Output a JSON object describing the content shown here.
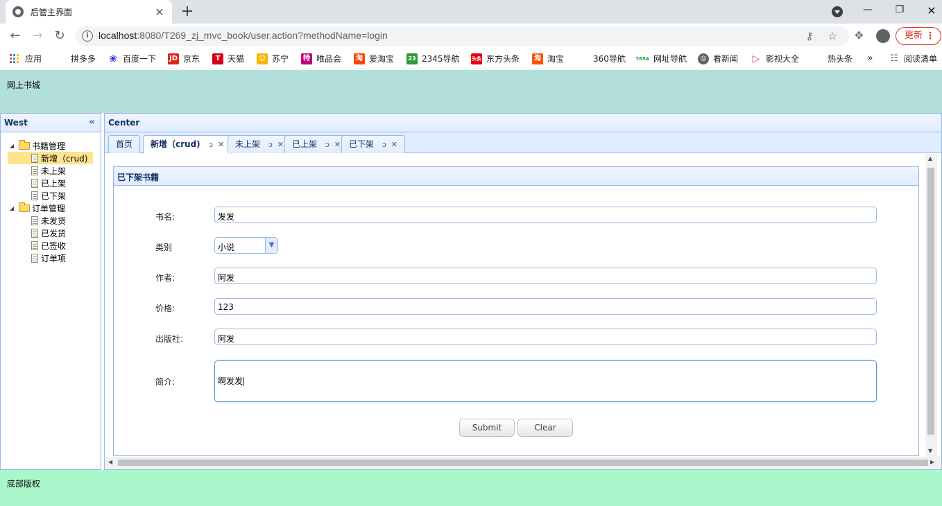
{
  "browser": {
    "tab_title": "后管主界面",
    "url_host": "localhost",
    "url_rest": ":8080/T269_zj_mvc_book/user.action?methodName=login",
    "update_label": "更新"
  },
  "bookmarks": [
    {
      "label": "应用",
      "icon": "apps-grid-icon"
    },
    {
      "label": "拼多多",
      "icon": ""
    },
    {
      "label": "百度一下",
      "icon": "baidu-paw-icon",
      "color": "#2932e1"
    },
    {
      "label": "京东",
      "icon": "jd-icon",
      "color": "#e1251b"
    },
    {
      "label": "天猫",
      "icon": "tmall-icon",
      "color": "#d40016"
    },
    {
      "label": "苏宁",
      "icon": "suning-icon",
      "color": "#f7b500"
    },
    {
      "label": "唯品会",
      "icon": "vip-icon",
      "color": "#c2007a"
    },
    {
      "label": "爱淘宝",
      "icon": "aitaobao-icon",
      "color": "#ff4400"
    },
    {
      "label": "2345导航",
      "icon": "2345-icon",
      "color": "#2a9d3a"
    },
    {
      "label": "东方头条",
      "icon": "toutiao-icon",
      "color": "#e60012"
    },
    {
      "label": "淘宝",
      "icon": "taobao-icon",
      "color": "#ff5000"
    },
    {
      "label": "360导航",
      "icon": ""
    },
    {
      "label": "网址导航",
      "icon": "7654-icon",
      "color": "#1aa03a"
    },
    {
      "label": "看新闻",
      "icon": "globe-icon",
      "color": "#5f6368"
    },
    {
      "label": "影视大全",
      "icon": "play-icon",
      "color": "#e8344e"
    },
    {
      "label": "热头条",
      "icon": ""
    },
    {
      "label": "阅读清单",
      "icon": "reading-list-icon"
    }
  ],
  "north": {
    "title": "网上书城"
  },
  "west": {
    "title": "West",
    "tree": [
      {
        "label": "书籍管理",
        "children": [
          "新增（crud)",
          "未上架",
          "已上架",
          "已下架"
        ]
      },
      {
        "label": "订单管理",
        "children": [
          "未发货",
          "已发货",
          "已签收",
          "订单项"
        ]
      }
    ],
    "selected": "新增（crud)"
  },
  "center": {
    "title": "Center",
    "tabs": [
      {
        "label": "首页"
      },
      {
        "label": "新增（crud)"
      },
      {
        "label": "未上架"
      },
      {
        "label": "已上架"
      },
      {
        "label": "已下架"
      }
    ],
    "active_tab": "新增（crud)"
  },
  "form": {
    "title": "已下架书籍",
    "name_label": "书名:",
    "name_value": "发发",
    "category_label": "类别",
    "category_value": "小说",
    "author_label": "作者:",
    "author_value": "阿发",
    "price_label": "价格:",
    "price_value": "123",
    "publisher_label": "出版社:",
    "publisher_value": "阿发",
    "intro_label": "简介:",
    "intro_value": "啊发发",
    "submit_label": "Submit",
    "clear_label": "Clear"
  },
  "south": {
    "text": "底部版权"
  },
  "colors": {
    "north_bg": "#b3dfda",
    "south_bg": "#a9f7cb",
    "border": "#95b8e7",
    "selected": "#ffe48d"
  }
}
